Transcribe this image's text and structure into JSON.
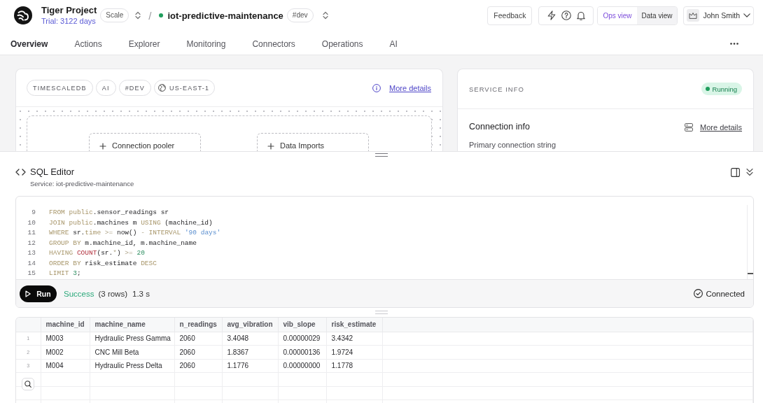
{
  "header": {
    "project": {
      "name": "Tiger Project",
      "trial": "Trial: 3122 days",
      "plan": "Scale"
    },
    "separator": "/",
    "service": {
      "name": "iot-predictive-maintenance",
      "environment": "#dev",
      "online": true
    },
    "feedback": "Feedback",
    "views": [
      {
        "label": "Ops view",
        "selected": true
      },
      {
        "label": "Data view",
        "selected": false
      }
    ],
    "user": {
      "name": "John Smith"
    }
  },
  "tabs": [
    {
      "label": "Overview",
      "selected": true
    },
    {
      "label": "Actions",
      "selected": false
    },
    {
      "label": "Explorer",
      "selected": false
    },
    {
      "label": "Monitoring",
      "selected": false
    },
    {
      "label": "Connectors",
      "selected": false
    },
    {
      "label": "Operations",
      "selected": false
    },
    {
      "label": "AI",
      "selected": false
    }
  ],
  "overview_card": {
    "tags": [
      {
        "label": "TIMESCALEDB",
        "kind": "tag"
      },
      {
        "label": "AI",
        "kind": "tag"
      },
      {
        "label": "#DEV",
        "kind": "tag"
      },
      {
        "label": "US-EAST-1",
        "kind": "region"
      }
    ],
    "details_link": "More details",
    "nodes": [
      {
        "label": "Connection pooler"
      },
      {
        "label": "Data Imports"
      }
    ]
  },
  "service_info": {
    "title": "SERVICE INFO",
    "status": "Running",
    "section": "Connection info",
    "details_link": "More details",
    "field_label": "Primary connection string"
  },
  "sql_editor": {
    "title": "SQL Editor",
    "subtitle": "Service: iot-predictive-maintenance",
    "lines": [
      {
        "number": "9",
        "tokens": [
          {
            "text": "FROM public",
            "kind": "keyword"
          },
          {
            "text": ".sensor_readings sr",
            "kind": "plain"
          }
        ]
      },
      {
        "number": "10",
        "tokens": [
          {
            "text": "JOIN public",
            "kind": "keyword"
          },
          {
            "text": ".machines m ",
            "kind": "plain"
          },
          {
            "text": "USING",
            "kind": "keyword"
          },
          {
            "text": " (machine_id)",
            "kind": "plain"
          }
        ]
      },
      {
        "number": "11",
        "tokens": [
          {
            "text": "WHERE",
            "kind": "keyword"
          },
          {
            "text": " sr.",
            "kind": "plain"
          },
          {
            "text": "time",
            "kind": "keyword"
          },
          {
            "text": " >=",
            "kind": "operator"
          },
          {
            "text": " now() ",
            "kind": "plain"
          },
          {
            "text": "-",
            "kind": "operator"
          },
          {
            "text": " INTERVAL",
            "kind": "keyword"
          },
          {
            "text": " '90 days'",
            "kind": "string"
          }
        ]
      },
      {
        "number": "12",
        "tokens": [
          {
            "text": "GROUP BY",
            "kind": "keyword"
          },
          {
            "text": " m.machine_id, m.machine_name",
            "kind": "plain"
          }
        ]
      },
      {
        "number": "13",
        "tokens": [
          {
            "text": "HAVING",
            "kind": "keyword"
          },
          {
            "text": " COUNT",
            "kind": "function"
          },
          {
            "text": "(sr.",
            "kind": "plain"
          },
          {
            "text": "*",
            "kind": "operator"
          },
          {
            "text": ") ",
            "kind": "plain"
          },
          {
            "text": ">=",
            "kind": "operator"
          },
          {
            "text": " 20",
            "kind": "number"
          }
        ]
      },
      {
        "number": "14",
        "tokens": [
          {
            "text": "ORDER BY",
            "kind": "keyword"
          },
          {
            "text": " risk_estimate ",
            "kind": "plain"
          },
          {
            "text": "DESC",
            "kind": "keyword"
          }
        ]
      },
      {
        "number": "15",
        "tokens": [
          {
            "text": "LIMIT",
            "kind": "keyword"
          },
          {
            "text": " 3",
            "kind": "number"
          },
          {
            "text": ";",
            "kind": "plain"
          }
        ]
      }
    ],
    "run_button": "Run",
    "result": {
      "status": "Success",
      "rows": "(3 rows)",
      "duration": "1.3 s"
    },
    "connection": "Connected"
  },
  "results": {
    "columns": [
      "machine_id",
      "machine_name",
      "n_readings",
      "avg_vibration",
      "vib_slope",
      "risk_estimate"
    ],
    "rows": [
      {
        "number": "1",
        "cells": [
          "M003",
          "Hydraulic Press Gamma",
          "2060",
          "3.4048",
          "0.00000029",
          "3.4342"
        ]
      },
      {
        "number": "2",
        "cells": [
          "M002",
          "CNC Mill Beta",
          "2060",
          "1.8367",
          "0.00000136",
          "1.9724"
        ]
      },
      {
        "number": "3",
        "cells": [
          "M004",
          "Hydraulic Press Delta",
          "2060",
          "1.1776",
          "0.00000000",
          "1.1778"
        ]
      }
    ]
  }
}
